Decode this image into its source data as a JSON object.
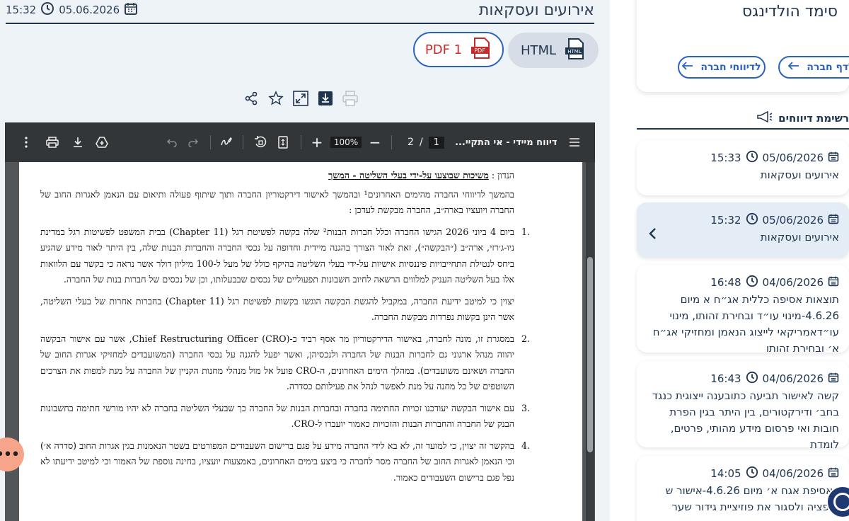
{
  "header": {
    "title": "אירועים ועסקאות",
    "time": "15:32",
    "date": "05.06.2026"
  },
  "formats": {
    "html_label": "HTML",
    "pdf_label": "PDF 1"
  },
  "actions": [
    "share-icon",
    "star-icon",
    "expand-icon",
    "download-icon",
    "print-icon"
  ],
  "viewer": {
    "doc_name": "דיווח מיידי - אי התקיי...",
    "page_current": "1",
    "page_sep": "/",
    "page_total": "2",
    "zoom": "100%"
  },
  "document": {
    "subject_label": "הנדון :",
    "subject_value": "משיכות שבוצעו על-ידי בעלי השליטה - המשך",
    "intro": "בהמשך לדיווחי החברה מהימים האחרונים¹ ובהמשך לאישור דירקטוריון החברה ותוך שיתוף פעולה ותיאום עם הנאמן לאגרות החוב של החברה ויועציו בארה״ב, החברה מבקשת לעדכן :",
    "items": [
      {
        "num": ".1",
        "text": "ביום 4 ביוני 2026 הגישו החברה וכלל חברות הבנות² שלה בקשה לפשיטת רגל (Chapter 11) בבית המשפט לפשיטות רגל במדינת ניו-ג׳רזי, ארה״ב (״הבקשה״), זאת לאור הצורך בהגנה מיידית וחדופה על נכסי החברה והחברות הבנות שלה, בין היתר לאור מידע שהגיע ביחס לנטילת התחייבויות פיננסיות אישיות על-ידי בעלי השליטה בהיקף כולל של מעל ל-100 מיליון דולר אשר נראה כי בקשר עם הלוואות אלו בעל השליטה העניק למלווים הרשאה לחיוב חשבונות תפעוליים של נכסים שבבעלותו, וכן של נכסים של חברות בנות של החברה."
      },
      {
        "num": "",
        "text": "יצוין כי למיטב ידיעת החברה, במקביל להגשת הבקשה הוגשו בקשות לפשיטת רגל (Chapter 11) בחברות אחרות של בעלי השליטה, אשר הינן בקשות נפרדות מבקשת החברה."
      },
      {
        "num": ".2",
        "text": "במסגרת זו, מונה לחברה, באישור הדירקטוריון מר אסף רביד כ-Chief Restructuring Officer (CRO), אשר עם אישור הבקשה יהווה מנהל ארגוני גם לחברות הבנות של החברה ולנכסיהן, ואשר יפעל להגנה על נכסי החברה (המשועבדים למחזיקי אגרות החוב של החברה ושאינם משועבדים). במהלך הימים האחרונים, ה-CRO פועל אל מול מנהלי מחנות הקניין של החברה על מנת למפות את הצרכים השוטפים של כל מחנה על מנת לאפשר לנהל את פעילותם כסדרה."
      },
      {
        "num": ".3",
        "text": "עם אישור הבקשה יעודכנו זכויות החתימה בחברה ובחברות הבנות של החברה כך שבעלי השליטה בחברה לא יהיו מורשי חתימה בחשבונות הבנק של החברה והחברות הבנות והזכויות כאמור יועברו ל-CRO."
      },
      {
        "num": ".4",
        "text": "בהקשר זה יצוין, כי למועד זה, לא בא לידי החברה מידע על פגם ברישום השעבודים המפורטים בשטר הנאמנות בגין אגרות החוב (סדרה א׳) וכי הנאמן לאגרות החוב של החברה מסר לחברה כי ביצע בימים האחרונים, באמצעות יועציו, בחינה נוספת של האמור וכי למיטב ידיעתו לא נפל פגם ברישום השעבודים כאמור."
      }
    ]
  },
  "sidebar": {
    "company_name": "סימד הולדינגס",
    "page_link": "לדף חברה",
    "reports_link": "לדיווחי חברה",
    "list_title": "רשימת דיווחים",
    "reports": [
      {
        "date": "05/06/2026",
        "time": "15:33",
        "title": "אירועים ועסקאות"
      },
      {
        "date": "05/06/2026",
        "time": "15:32",
        "title": "אירועים ועסקאות"
      },
      {
        "date": "04/06/2026",
        "time": "16:48",
        "title": "תוצאות אסיפה כללית אג״ח א מיום 4.6.26-מינוי עו״ד ובחירת זהותו, מינוי עו״דאמריקאי לייצוג הנאמן ומחזיקי אג״ח א׳ ובחירת זהותו"
      },
      {
        "date": "04/06/2026",
        "time": "16:43",
        "title": "קשה לאישור תביעה כתובענה ייצוגית כנגד בחב׳ ודירקטורים, בין היתר בגין הפרת חובות ואי פרסום מידע מהותי, פרטים, לומדת"
      },
      {
        "date": "04/06/2026",
        "time": "14:05",
        "title": "ן אסיפת אגח א׳ מיום 4.6.26-אישור ש אופציה ולסגור את פוזיציית גידור שער"
      }
    ]
  }
}
